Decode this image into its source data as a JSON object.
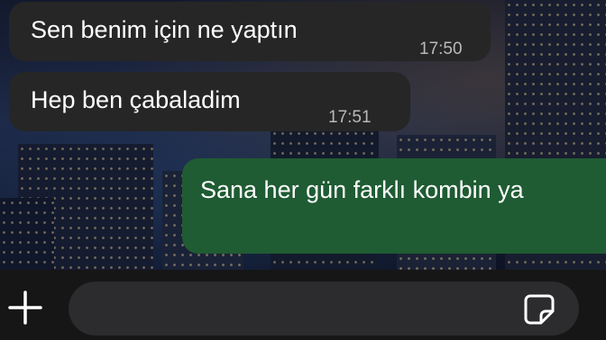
{
  "messages": [
    {
      "direction": "incoming",
      "text": "Sen benim için ne yaptın",
      "time": "17:50"
    },
    {
      "direction": "incoming",
      "text": "Hep ben çabaladim",
      "time": "17:51"
    },
    {
      "direction": "outgoing",
      "text": "Sana her gün farklı kombin ya"
    }
  ],
  "composer": {
    "attach_icon": "plus-icon",
    "sticker_icon": "sticker-icon",
    "input_value": ""
  },
  "colors": {
    "incoming_bubble": "#262626",
    "outgoing_bubble": "#1f5b33",
    "bar": "#161616",
    "input": "#2c2c2e"
  }
}
